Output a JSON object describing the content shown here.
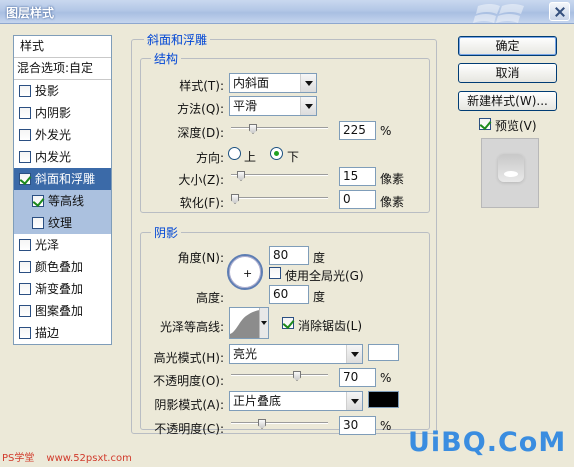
{
  "window": {
    "title": "图层样式"
  },
  "left_panel": {
    "style_header": "样式",
    "blend_options": "混合选项:自定",
    "items": [
      {
        "label": "投影",
        "checked": false
      },
      {
        "label": "内阴影",
        "checked": false
      },
      {
        "label": "外发光",
        "checked": false
      },
      {
        "label": "内发光",
        "checked": false
      },
      {
        "label": "斜面和浮雕",
        "checked": true,
        "selected": true
      },
      {
        "label": "等高线",
        "checked": true,
        "sub": true
      },
      {
        "label": "纹理",
        "checked": false,
        "sub": true
      },
      {
        "label": "光泽",
        "checked": false
      },
      {
        "label": "颜色叠加",
        "checked": false
      },
      {
        "label": "渐变叠加",
        "checked": false
      },
      {
        "label": "图案叠加",
        "checked": false
      },
      {
        "label": "描边",
        "checked": false
      }
    ]
  },
  "bevel": {
    "section_title": "斜面和浮雕",
    "structure_title": "结构",
    "style_label": "样式(T):",
    "style_value": "内斜面",
    "technique_label": "方法(Q):",
    "technique_value": "平滑",
    "depth_label": "深度(D):",
    "depth_value": "225",
    "depth_unit": "%",
    "depth_slider": 0.2,
    "direction_label": "方向:",
    "dir_up": "上",
    "dir_down": "下",
    "dir_selected": "down",
    "size_label": "大小(Z):",
    "size_value": "15",
    "size_unit": "像素",
    "size_slider": 0.07,
    "soften_label": "软化(F):",
    "soften_value": "0",
    "soften_unit": "像素",
    "soften_slider": 0
  },
  "shading": {
    "title": "阴影",
    "angle_label": "角度(N):",
    "angle_value": "80",
    "angle_unit": "度",
    "global_light_label": "使用全局光(G)",
    "altitude_label": "高度:",
    "altitude_value": "60",
    "altitude_unit": "度",
    "gloss_label": "光泽等高线:",
    "antialias_label": "消除锯齿(L)",
    "highlight_mode_label": "高光模式(H):",
    "highlight_mode_value": "亮光",
    "highlight_color": "#ffffff",
    "highlight_opacity_label": "不透明度(O):",
    "highlight_opacity_value": "70",
    "highlight_opacity_slider": 0.7,
    "shadow_mode_label": "阴影模式(A):",
    "shadow_mode_value": "正片叠底",
    "shadow_color": "#000000",
    "shadow_opacity_label": "不透明度(C):",
    "shadow_opacity_value": "30",
    "shadow_opacity_slider": 0.3,
    "percent": "%"
  },
  "buttons": {
    "ok": "确定",
    "cancel": "取消",
    "new_style": "新建样式(W)...",
    "preview": "预览(V)"
  },
  "watermark": {
    "brand": "UiBQ.CoM",
    "left_text": "PS学堂",
    "left_url": "www.52psxt.com"
  }
}
